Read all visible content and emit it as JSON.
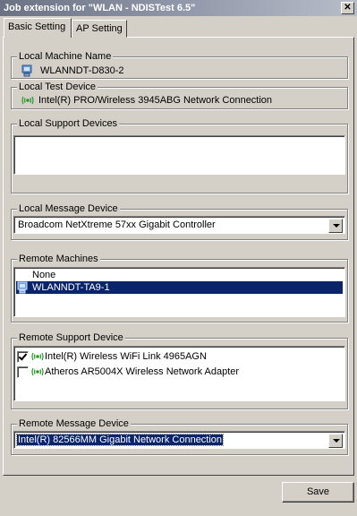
{
  "window": {
    "title": "Job extension for \"WLAN - NDISTest 6.5\"",
    "close_glyph": "✕"
  },
  "tabs": [
    {
      "label": "Basic Setting",
      "active": true
    },
    {
      "label": "AP Setting",
      "active": false
    }
  ],
  "local_machine": {
    "legend": "Local Machine Name",
    "value": "WLANNDT-D830-2",
    "icon": "computer-icon"
  },
  "local_test_device": {
    "legend": "Local Test Device",
    "value": "Intel(R) PRO/Wireless 3945ABG Network Connection",
    "icon": "wireless-adapter-icon"
  },
  "local_support_devices": {
    "legend": "Local Support Devices",
    "items": []
  },
  "local_message_device": {
    "legend": "Local Message Device",
    "selected": "Broadcom NetXtreme 57xx Gigabit Controller"
  },
  "remote_machines": {
    "legend": "Remote Machines",
    "items": [
      {
        "label": "None",
        "selected": false
      },
      {
        "label": "WLANNDT-TA9-1",
        "selected": true,
        "icon": "computer-icon"
      }
    ]
  },
  "remote_support_device": {
    "legend": "Remote Support Device",
    "items": [
      {
        "label": "Intel(R) Wireless WiFi Link 4965AGN",
        "checked": true,
        "icon": "wireless-adapter-icon"
      },
      {
        "label": "Atheros AR5004X Wireless Network Adapter",
        "checked": false,
        "icon": "wireless-adapter-icon"
      }
    ]
  },
  "remote_message_device": {
    "legend": "Remote Message Device",
    "selected": "Intel(R) 82566MM Gigabit Network Connection"
  },
  "buttons": {
    "save": "Save"
  },
  "colors": {
    "face": "#d4d0c8",
    "selection": "#0a246a",
    "wireless_icon": "#2a9a2a"
  }
}
